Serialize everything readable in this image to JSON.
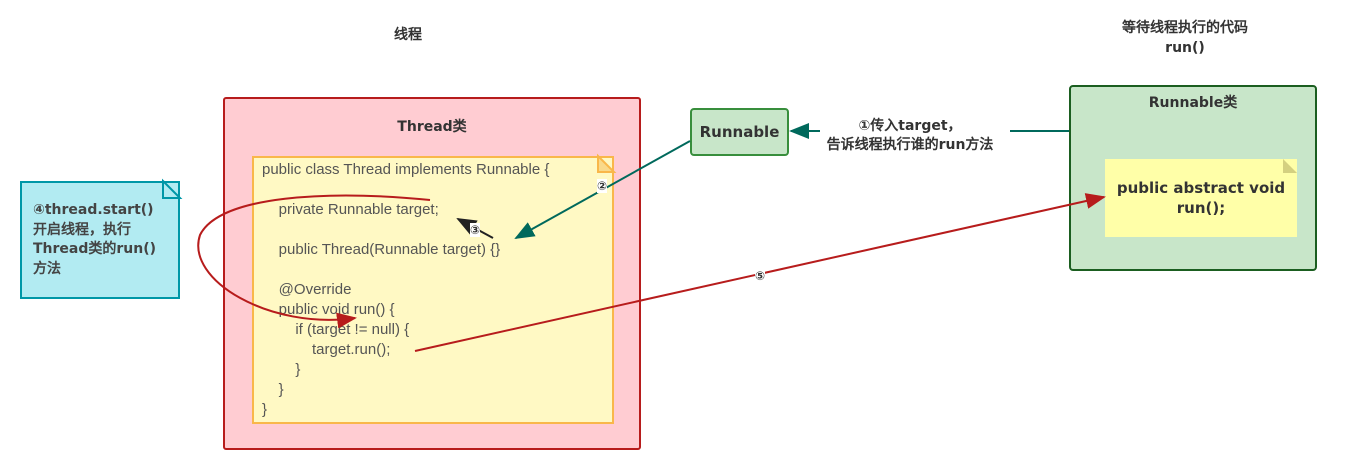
{
  "titles": {
    "thread_section": "线程",
    "waiting_code_line1": "等待线程执行的代码",
    "waiting_code_line2": "run()"
  },
  "thread_class": {
    "title": "Thread类",
    "code_lines": [
      "public class Thread implements Runnable {",
      "",
      "    private Runnable target;",
      "",
      "    public Thread(Runnable target) {}",
      "",
      "    @Override",
      "    public void run() {",
      "        if (target != null) {",
      "            target.run();",
      "        }",
      "    }",
      "}"
    ]
  },
  "runnable_node": {
    "label": "Runnable"
  },
  "runnable_class": {
    "title": "Runnable类",
    "method_line1": "public abstract void",
    "method_line2": "run();"
  },
  "step1": {
    "line1": "①传入target，",
    "line2": "告诉线程执行谁的run方法"
  },
  "step4": {
    "lines": [
      "④thread.start()",
      "开启线程，执行",
      "Thread类的run()",
      "方法"
    ]
  },
  "badges": {
    "step2": "②",
    "step3": "③",
    "step5": "⑤"
  },
  "colors": {
    "teal": "#00695c",
    "red": "#b71c1c",
    "thread_fill": "#ffccd2",
    "note_fill": "#fff9c4",
    "green_fill": "#c8e6c9",
    "blue_fill": "#b2ebf2"
  }
}
